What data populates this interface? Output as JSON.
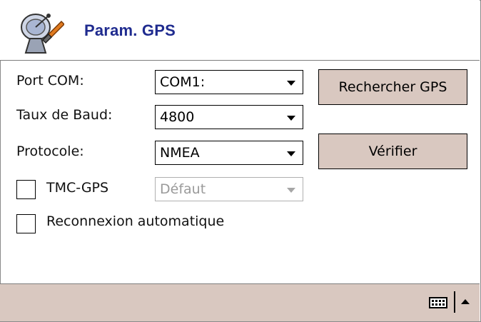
{
  "header": {
    "title": "Param. GPS",
    "icon": "satellite-dish-wrench-icon"
  },
  "form": {
    "port_com": {
      "label": "Port COM:",
      "value": "COM1:"
    },
    "baud": {
      "label": "Taux de Baud:",
      "value": "4800"
    },
    "protocol": {
      "label": "Protocole:",
      "value": "NMEA"
    },
    "tmc": {
      "label": "TMC-GPS",
      "value": "Défaut",
      "checked": false,
      "disabled": true
    },
    "reconnect": {
      "label": "Reconnexion automatique",
      "checked": false
    }
  },
  "buttons": {
    "search": "Rechercher GPS",
    "verify": "Vérifier"
  },
  "colors": {
    "title": "#1f2b8f",
    "button_bg": "#d9c8c0",
    "bar_bg": "#d9c8c0"
  },
  "bottombar": {
    "keyboard_icon": "keyboard-icon",
    "menu_icon": "up-arrow-icon"
  }
}
